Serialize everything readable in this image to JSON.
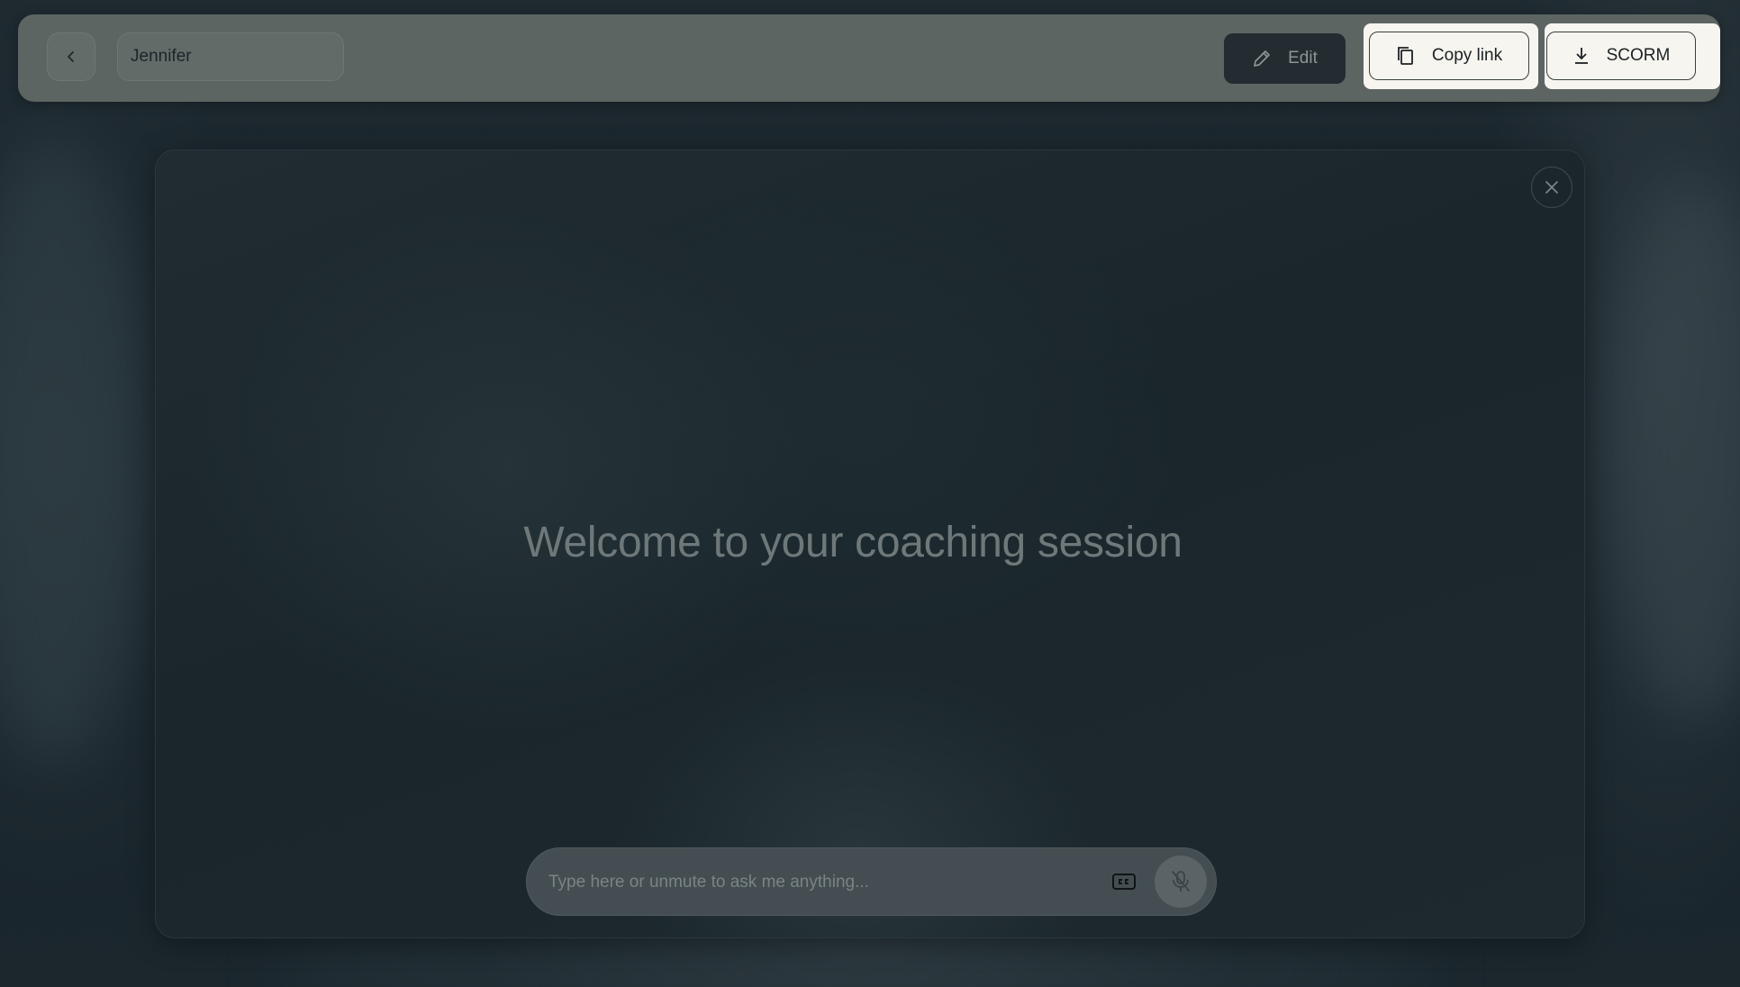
{
  "header": {
    "back_icon": "chevron-left-icon",
    "name_value": "Jennifer",
    "edit_label": "Edit",
    "edit_icon": "pencil-icon",
    "copy_link_label": "Copy link",
    "copy_icon": "copy-icon",
    "scorm_label": "SCORM",
    "scorm_icon": "download-icon"
  },
  "session": {
    "close_icon": "close-icon",
    "welcome_text": "Welcome to your coaching session",
    "input_placeholder": "Type here or unmute to ask me anything...",
    "input_value": "",
    "cc_icon": "closed-captions-icon",
    "mic_icon": "mic-muted-icon"
  },
  "colors": {
    "top_bar": "#5d6563",
    "edit_button": "#222c31",
    "light_button": "#f7f5ef",
    "panel": "#1c282e",
    "welcome_text": "#6f7879",
    "chat_bar": "#444e52"
  }
}
